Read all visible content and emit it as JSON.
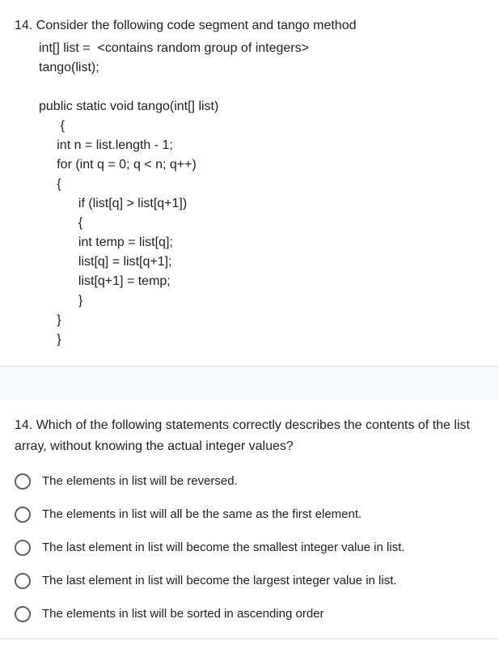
{
  "block1": {
    "intro": "14. Consider the following code segment and tango method",
    "line1": "int[] list =  <contains random group of integers>",
    "line2": "tango(list);",
    "sig": "public static void tango(int[] list)",
    "brace_open1": "{",
    "stmt_n": "int n = list.length - 1;",
    "stmt_for": "for (int q = 0; q < n; q++)",
    "brace_open2": "{",
    "stmt_if": "if (list[q] > list[q+1])",
    "brace_open3": "{",
    "stmt_temp": "int temp = list[q];",
    "stmt_swap1": "list[q] = list[q+1];",
    "stmt_swap2": "list[q+1] = temp;",
    "brace_close3": "}",
    "brace_close2": "}",
    "brace_close1": "}"
  },
  "block2": {
    "question": "14. Which of the following statements correctly describes the contents of the  list array, without knowing the actual integer values?",
    "options": [
      "The elements in list will be reversed.",
      "The elements in list will all be the same as the first element.",
      "The last element in list will become the smallest integer value in list.",
      "The last element in list will become the largest integer value in list.",
      "The elements in list will be sorted in ascending order"
    ]
  }
}
